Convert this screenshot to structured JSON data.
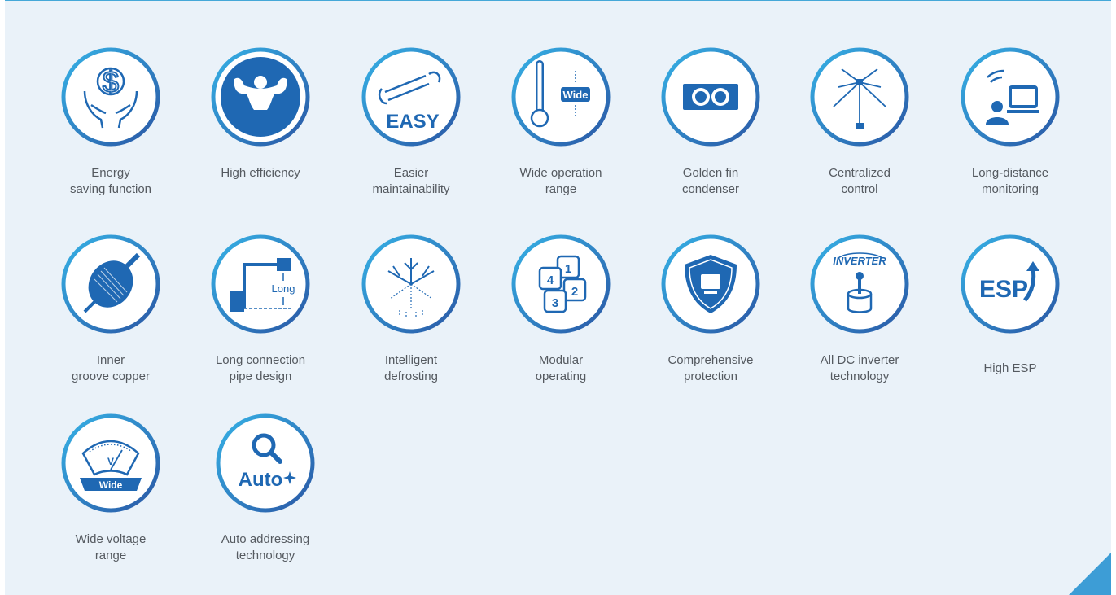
{
  "colors": {
    "accent_blue": "#1f68b3",
    "ring_light": "#36b2e6",
    "ring_dark": "#2a57a5",
    "panel_bg": "#eaf2f9",
    "text": "#555a60"
  },
  "features": [
    {
      "label": "Energy\nsaving function",
      "icon": "money-hands-icon"
    },
    {
      "label": "High efficiency",
      "icon": "muscle-man-icon"
    },
    {
      "label": "Easier\nmaintainability",
      "icon": "wrench-easy-icon",
      "icon_text": "EASY"
    },
    {
      "label": "Wide operation\nrange",
      "icon": "thermometer-wide-icon",
      "icon_text": "Wide"
    },
    {
      "label": "Golden fin\ncondenser",
      "icon": "condenser-icon"
    },
    {
      "label": "Centralized\ncontrol",
      "icon": "centralized-control-icon"
    },
    {
      "label": "Long-distance\nmonitoring",
      "icon": "remote-monitoring-icon"
    },
    {
      "label": "Inner\ngroove copper",
      "icon": "copper-pipe-icon"
    },
    {
      "label": "Long connection\npipe design",
      "icon": "long-pipe-icon",
      "icon_text": "Long"
    },
    {
      "label": "Intelligent\ndefrosting",
      "icon": "snowflake-defrost-icon"
    },
    {
      "label": "Modular\noperating",
      "icon": "modular-icon",
      "icon_nums": [
        "1",
        "2",
        "3",
        "4"
      ]
    },
    {
      "label": "Comprehensive\nprotection",
      "icon": "shield-icon"
    },
    {
      "label": "All DC inverter\ntechnology",
      "icon": "inverter-joystick-icon",
      "icon_text": "INVERTER"
    },
    {
      "label": "High ESP",
      "icon": "esp-arrow-icon",
      "icon_text": "ESP"
    },
    {
      "label": "Wide voltage\nrange",
      "icon": "voltmeter-icon",
      "icon_text": "Wide",
      "icon_text2": "V"
    },
    {
      "label": "Auto addressing\ntechnology",
      "icon": "auto-search-icon",
      "icon_text": "Auto"
    }
  ]
}
